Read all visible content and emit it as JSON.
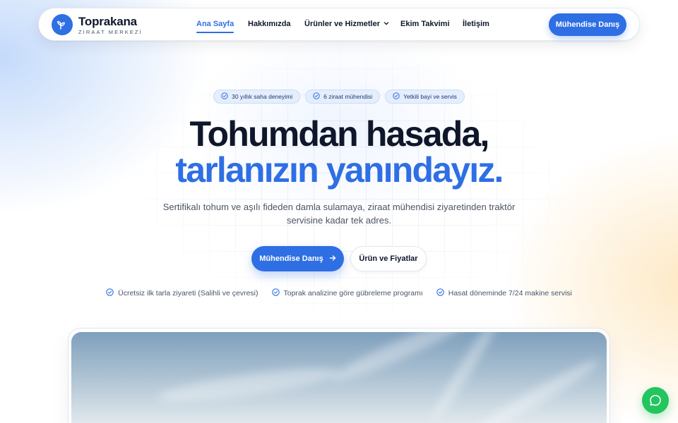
{
  "brand": {
    "name": "Toprakana",
    "tagline": "ZİRAAT MERKEZİ",
    "logo_icon": "sprout-icon",
    "color": "#2f6fe4"
  },
  "nav": {
    "items": [
      {
        "label": "Ana Sayfa",
        "active": true
      },
      {
        "label": "Hakkımızda",
        "active": false
      },
      {
        "label": "Ürünler ve Hizmetler",
        "active": false,
        "has_dropdown": true
      },
      {
        "label": "Ekim Takvimi",
        "active": false
      },
      {
        "label": "İletişim",
        "active": false
      }
    ],
    "cta_label": "Mühendise Danış"
  },
  "hero": {
    "badges": [
      "30 yıllık saha deneyimi",
      "6 ziraat mühendisi",
      "Yetkili bayi ve servis"
    ],
    "title_line1": "Tohumdan hasada,",
    "title_line2": "tarlanızın yanındayız.",
    "description": "Sertifikalı tohum ve aşılı fideden damla sulamaya, ziraat mühendisi ziyaretinden traktör servisine kadar tek adres.",
    "primary_cta": "Mühendise Danış",
    "secondary_cta": "Ürün ve Fiyatlar",
    "features": [
      "Ücretsiz ilk tarla ziyareti (Salihli ve çevresi)",
      "Toprak analizine göre gübreleme programı",
      "Hasat döneminde 7/24 makine servisi"
    ]
  },
  "chat": {
    "icon": "whatsapp-icon",
    "color": "#22c55e"
  }
}
